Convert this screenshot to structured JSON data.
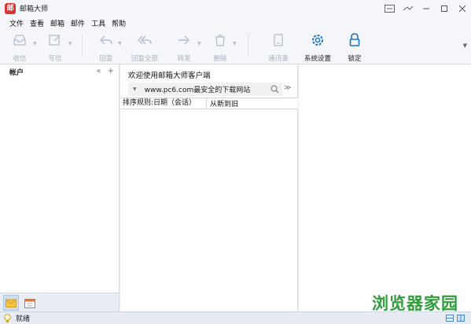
{
  "app": {
    "title": "邮箱大师",
    "logo_char": "邮"
  },
  "menu": [
    "文件",
    "查看",
    "邮箱",
    "邮件",
    "工具",
    "帮助"
  ],
  "toolbar": {
    "receive": "收信",
    "compose": "写信",
    "reply": "回复",
    "reply_all": "回复全部",
    "forward": "转发",
    "delete": "删除",
    "contacts": "通讯录",
    "settings": "系统设置",
    "lock": "锁定"
  },
  "sidebar": {
    "title": "帐户"
  },
  "main": {
    "welcome": "欢迎使用邮箱大师客户端",
    "url": "www.pc6.com最安全的下载网站",
    "sort_label": "排序规则:日期（会话）",
    "sort_order": "从新到旧"
  },
  "status": {
    "text": "就绪"
  },
  "watermark": "浏览器家园",
  "colors": {
    "logo": "#e23232",
    "settings_icon": "#1e73c8",
    "watermark": "#2f9d3a"
  }
}
